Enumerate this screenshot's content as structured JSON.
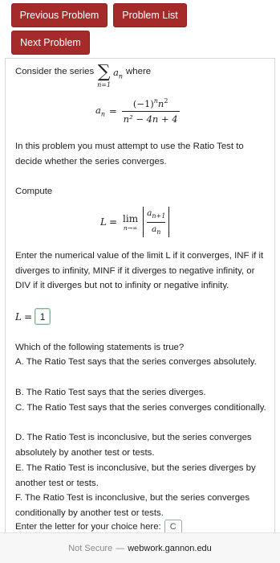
{
  "nav": {
    "previous_label": "Previous Problem",
    "list_label": "Problem List",
    "next_label": "Next Problem"
  },
  "problem": {
    "intro_before": "Consider the series",
    "intro_after": "where",
    "sigma_sub": "n=1",
    "an_lhs": "a",
    "an_lhs_sub": "n",
    "an_num": "(−1)",
    "an_num_exp1": "n",
    "an_num_base": "n",
    "an_num_exp2": "2",
    "an_den": "n² − 4n + 4",
    "ratio_text": "In this problem you must attempt to use the Ratio Test to decide whether the series converges.",
    "compute_label": "Compute",
    "limit_L": "L",
    "limit_word": "lim",
    "limit_sub": "n→∞",
    "limit_num": "a",
    "limit_num_sub": "n+1",
    "limit_den": "a",
    "limit_den_sub": "n",
    "enter_text": "Enter the numerical value of the limit L if it converges, INF if it diverges to infinity, MINF if it diverges to negative infinity, or DIV if it diverges but not to infinity or negative infinity.",
    "answer_label": "L",
    "answer_value": "1",
    "question": "Which of the following statements is true?",
    "options": [
      "A. The Ratio Test says that the series converges absolutely.",
      "B. The Ratio Test says that the series diverges.",
      "C. The Ratio Test says that the series converges conditionally.",
      "D. The Ratio Test is inconclusive, but the series converges absolutely by another test or tests.",
      "E. The Ratio Test is inconclusive, but the series diverges by another test or tests.",
      "F. The Ratio Test is inconclusive, but the series converges conditionally by another test or tests."
    ],
    "choice_prompt": "Enter the letter for your choice here:",
    "choice_value": "C"
  },
  "browser": {
    "security": "Not Secure",
    "separator": "—",
    "domain": "webwork.gannon.edu"
  },
  "colors": {
    "button_bg": "#a52a2a",
    "button_text": "#ffffff"
  }
}
